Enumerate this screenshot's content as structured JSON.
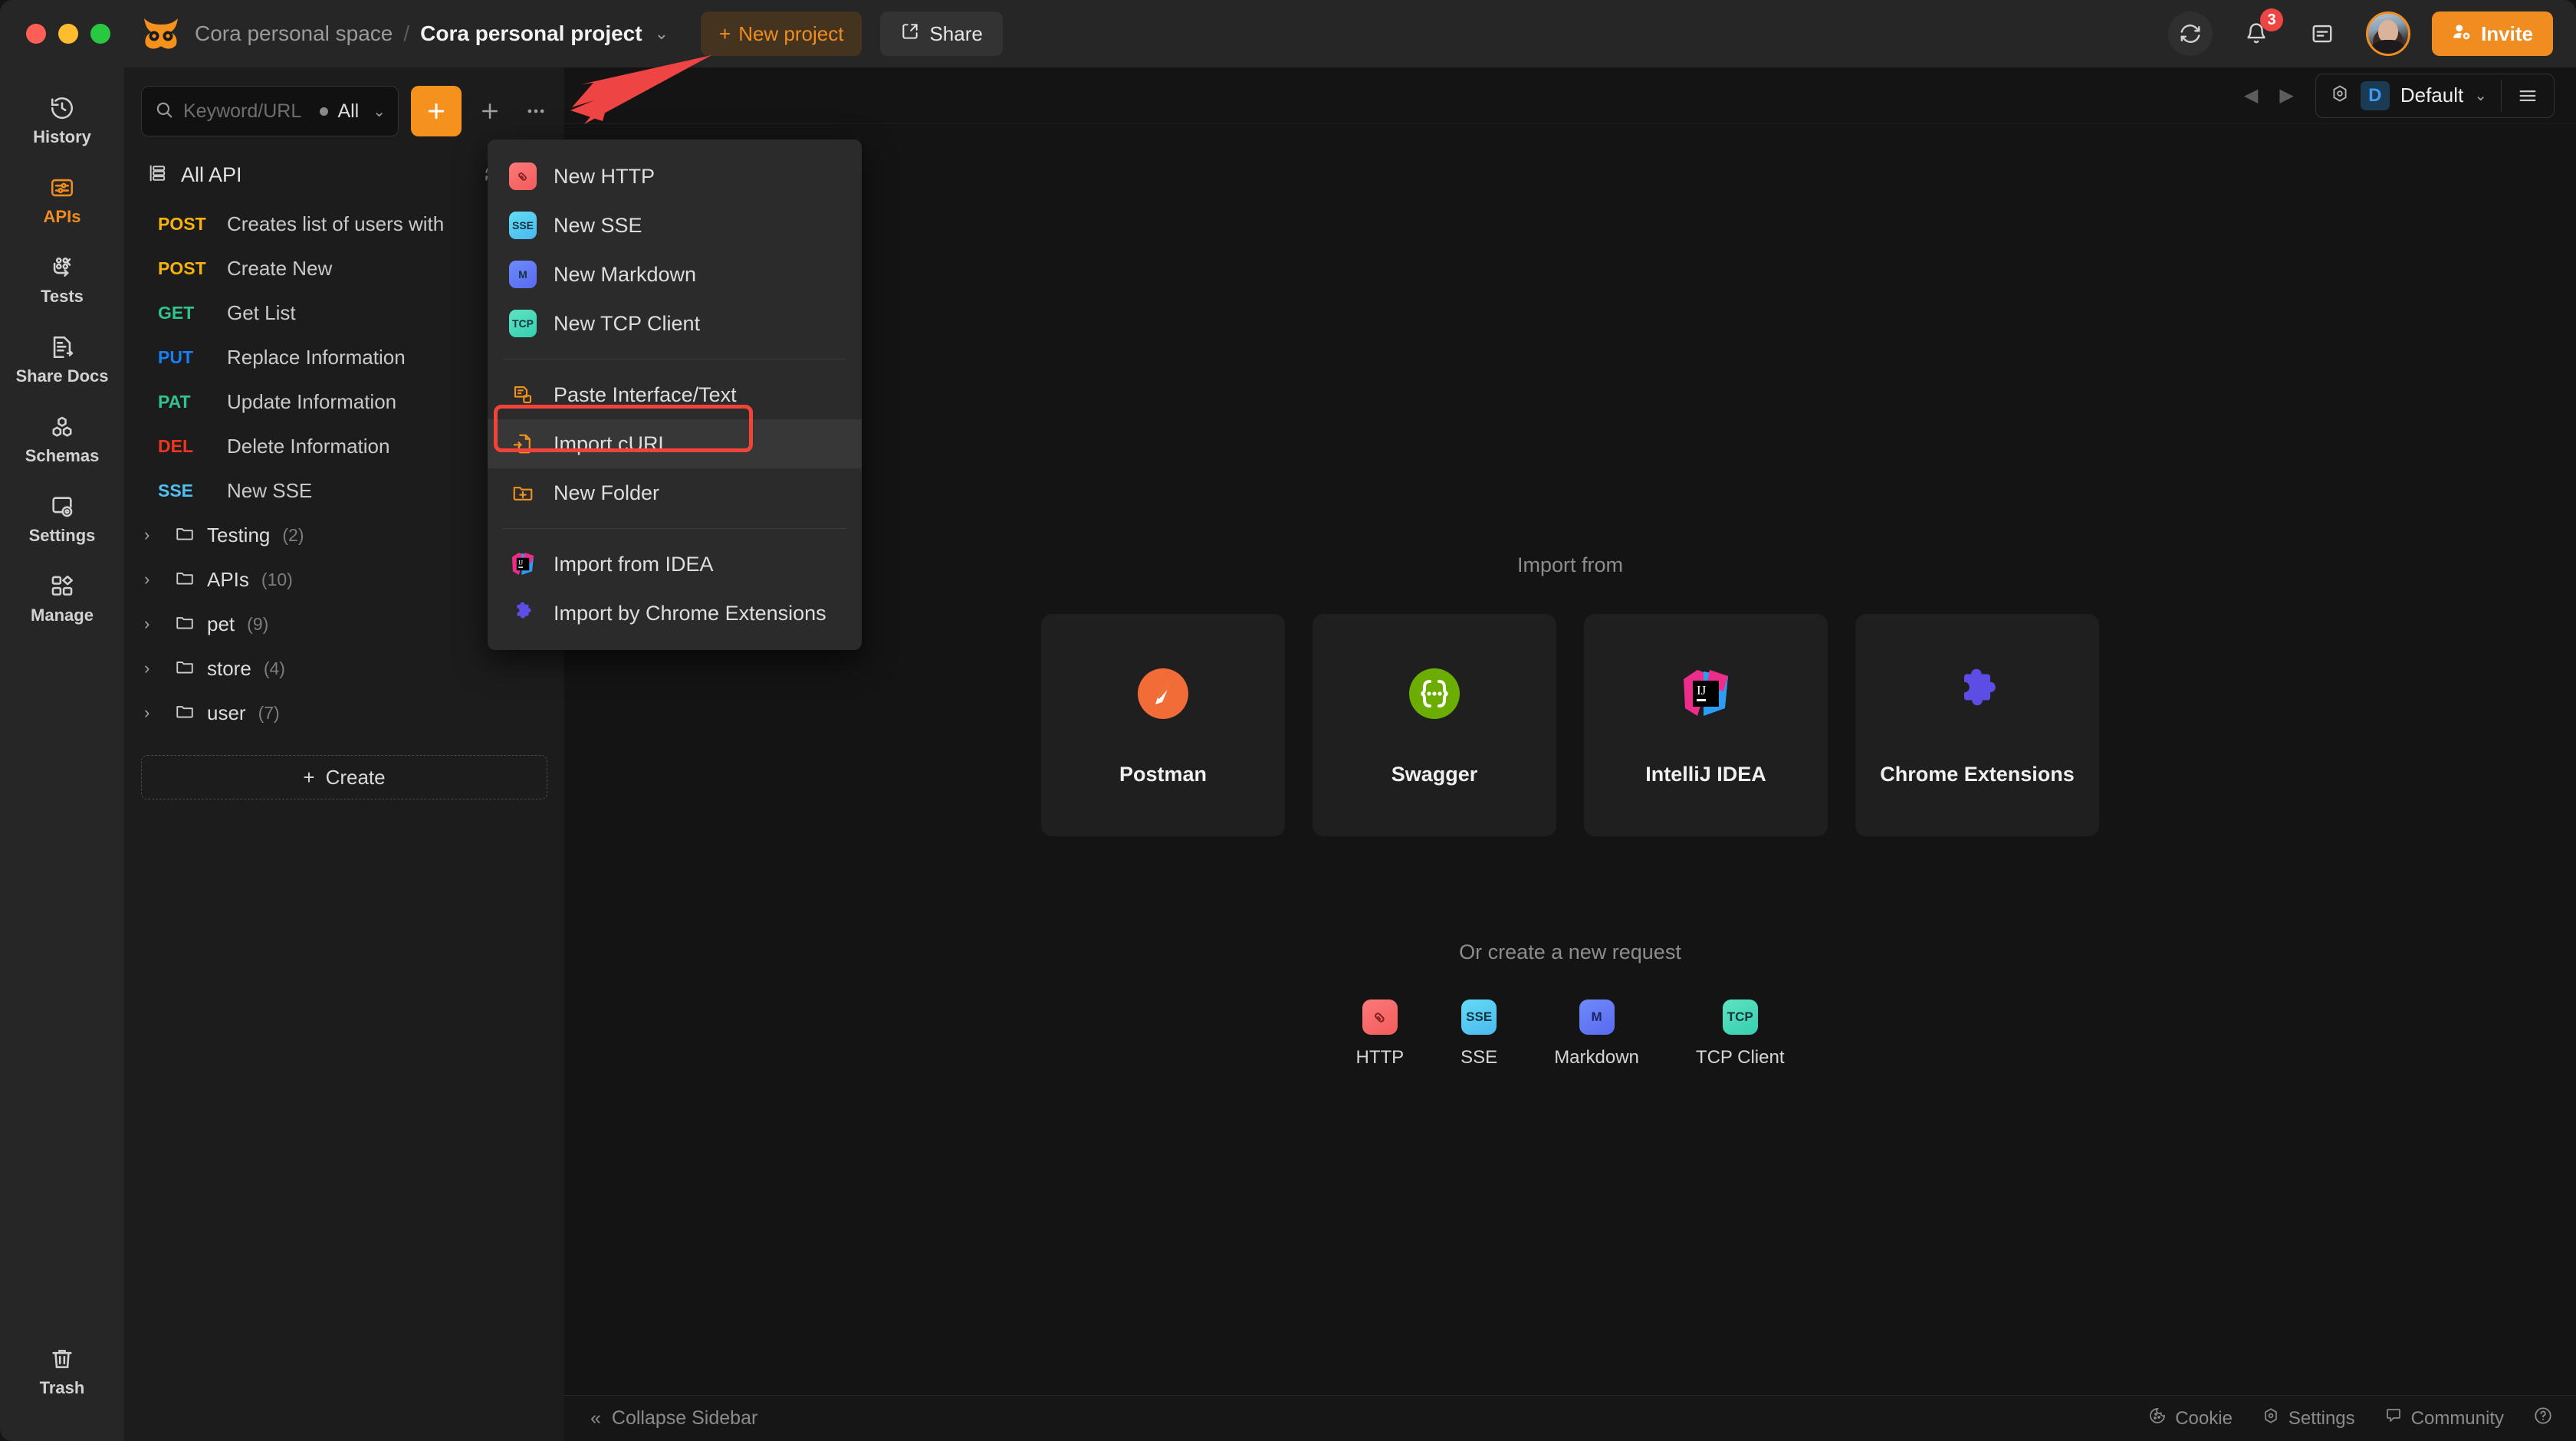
{
  "titlebar": {
    "space": "Cora personal space",
    "separator": "/",
    "project": "Cora personal project",
    "caret": "⌄",
    "new_project_label": "New project",
    "new_project_plus": "+",
    "share_label": "Share",
    "notification_count": "3",
    "invite_label": "Invite",
    "accent_color": "#f08c20"
  },
  "rail": {
    "items": [
      {
        "label": "History",
        "icon": "history-icon",
        "active": false
      },
      {
        "label": "APIs",
        "icon": "apis-icon",
        "active": true
      },
      {
        "label": "Tests",
        "icon": "tests-icon",
        "active": false
      },
      {
        "label": "Share Docs",
        "icon": "share-docs-icon",
        "active": false
      },
      {
        "label": "Schemas",
        "icon": "schemas-icon",
        "active": false
      },
      {
        "label": "Settings",
        "icon": "settings-icon",
        "active": false
      },
      {
        "label": "Manage",
        "icon": "manage-icon",
        "active": false
      }
    ],
    "trash": {
      "label": "Trash",
      "icon": "trash-icon"
    }
  },
  "sidebar": {
    "search": {
      "placeholder": "Keyword/URL",
      "filter": "All",
      "caret": "⌄"
    },
    "plus_button": "+",
    "all_api": {
      "label": "All API"
    },
    "apis": [
      {
        "method": "POST",
        "cls": "m-post",
        "name": "Creates list of users with"
      },
      {
        "method": "POST",
        "cls": "m-post",
        "name": "Create New"
      },
      {
        "method": "GET",
        "cls": "m-get",
        "name": "Get List"
      },
      {
        "method": "PUT",
        "cls": "m-put",
        "name": "Replace Information"
      },
      {
        "method": "PAT",
        "cls": "m-pat",
        "name": "Update Information"
      },
      {
        "method": "DEL",
        "cls": "m-del",
        "name": "Delete Information"
      },
      {
        "method": "SSE",
        "cls": "m-sse",
        "name": "New SSE"
      }
    ],
    "folders": [
      {
        "name": "Testing",
        "count": "(2)"
      },
      {
        "name": "APIs",
        "count": "(10)"
      },
      {
        "name": "pet",
        "count": "(9)"
      },
      {
        "name": "store",
        "count": "(4)"
      },
      {
        "name": "user",
        "count": "(7)"
      }
    ],
    "create_label": "Create",
    "create_plus": "+"
  },
  "menu": {
    "items": [
      {
        "label": "New HTTP",
        "icon": "http-tile",
        "kind": "tile",
        "tile": "tile-http",
        "glyph": "",
        "hl": false
      },
      {
        "label": "New SSE",
        "icon": "sse-tile",
        "kind": "tile",
        "tile": "tile-sse",
        "glyph": "SSE",
        "hl": false
      },
      {
        "label": "New Markdown",
        "icon": "markdown-tile",
        "kind": "tile",
        "tile": "tile-md",
        "glyph": "M",
        "hl": false
      },
      {
        "label": "New TCP Client",
        "icon": "tcp-tile",
        "kind": "tile",
        "tile": "tile-tcp",
        "glyph": "TCP",
        "hl": false
      }
    ],
    "items2": [
      {
        "label": "Paste Interface/Text",
        "icon": "paste-interface-icon",
        "hl": false
      },
      {
        "label": "Import cURL",
        "icon": "import-curl-icon",
        "hl": true
      },
      {
        "label": "New Folder",
        "icon": "new-folder-icon",
        "hl": false
      }
    ],
    "items3": [
      {
        "label": "Import from IDEA",
        "icon": "intellij-idea-icon"
      },
      {
        "label": "Import by Chrome Extensions",
        "icon": "chrome-extension-icon"
      }
    ],
    "highlight_color": "#f2433b"
  },
  "main": {
    "env": {
      "name": "Default",
      "initial": "D",
      "caret": "⌄"
    },
    "nav_prev": "◀",
    "nav_next": "▶",
    "import_title": "Import from",
    "cards": [
      {
        "label": "Postman",
        "icon": "postman-icon"
      },
      {
        "label": "Swagger",
        "icon": "swagger-icon"
      },
      {
        "label": "IntelliJ IDEA",
        "icon": "intellij-idea-icon"
      },
      {
        "label": "Chrome Extensions",
        "icon": "chrome-extension-icon"
      }
    ],
    "create_title": "Or create a new request",
    "quick": [
      {
        "label": "HTTP",
        "tile": "tile-http",
        "glyph": ""
      },
      {
        "label": "SSE",
        "tile": "tile-sse",
        "glyph": "SSE"
      },
      {
        "label": "Markdown",
        "tile": "tile-md",
        "glyph": "M"
      },
      {
        "label": "TCP Client",
        "tile": "tile-tcp",
        "glyph": "TCP"
      }
    ]
  },
  "footer": {
    "collapse_label": "Collapse Sidebar",
    "collapse_chevron": "«",
    "items": [
      {
        "label": "Cookie",
        "icon": "cookie-icon"
      },
      {
        "label": "Settings",
        "icon": "settings-gear-icon"
      },
      {
        "label": "Community",
        "icon": "community-icon"
      }
    ],
    "help": "?"
  }
}
